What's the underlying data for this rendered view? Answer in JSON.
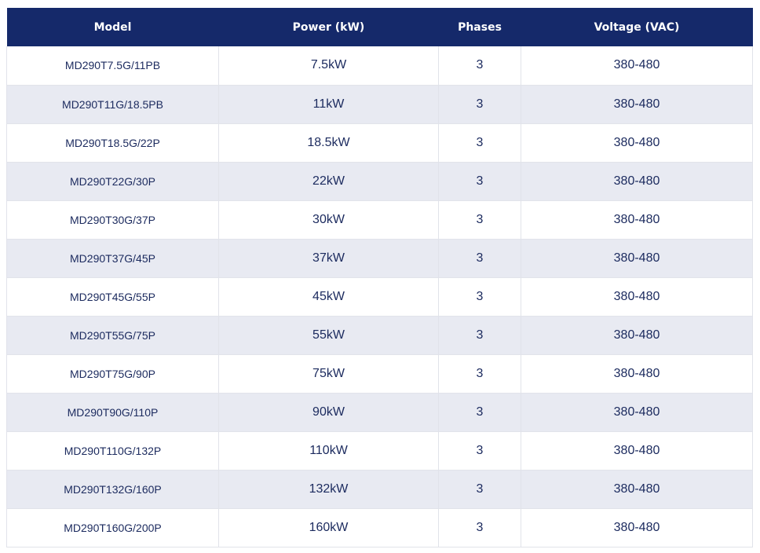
{
  "table": {
    "headers": {
      "model": "Model",
      "power": "Power (kW)",
      "phases": "Phases",
      "voltage": "Voltage (VAC)"
    },
    "rows": [
      {
        "model": "MD290T7.5G/11PB",
        "power": "7.5kW",
        "phases": "3",
        "voltage": "380-480"
      },
      {
        "model": "MD290T11G/18.5PB",
        "power": "11kW",
        "phases": "3",
        "voltage": "380-480"
      },
      {
        "model": "MD290T18.5G/22P",
        "power": "18.5kW",
        "phases": "3",
        "voltage": "380-480"
      },
      {
        "model": "MD290T22G/30P",
        "power": "22kW",
        "phases": "3",
        "voltage": "380-480"
      },
      {
        "model": "MD290T30G/37P",
        "power": "30kW",
        "phases": "3",
        "voltage": "380-480"
      },
      {
        "model": "MD290T37G/45P",
        "power": "37kW",
        "phases": "3",
        "voltage": "380-480"
      },
      {
        "model": "MD290T45G/55P",
        "power": "45kW",
        "phases": "3",
        "voltage": "380-480"
      },
      {
        "model": "MD290T55G/75P",
        "power": "55kW",
        "phases": "3",
        "voltage": "380-480"
      },
      {
        "model": "MD290T75G/90P",
        "power": "75kW",
        "phases": "3",
        "voltage": "380-480"
      },
      {
        "model": "MD290T90G/110P",
        "power": "90kW",
        "phases": "3",
        "voltage": "380-480"
      },
      {
        "model": "MD290T110G/132P",
        "power": "110kW",
        "phases": "3",
        "voltage": "380-480"
      },
      {
        "model": "MD290T132G/160P",
        "power": "132kW",
        "phases": "3",
        "voltage": "380-480"
      },
      {
        "model": "MD290T160G/200P",
        "power": "160kW",
        "phases": "3",
        "voltage": "380-480"
      }
    ]
  },
  "colors": {
    "header_bg": "#15296a",
    "header_text": "#ffffff",
    "cell_text": "#1b2a5e",
    "stripe": "#e8eaf2",
    "border": "#e1e3ea"
  }
}
